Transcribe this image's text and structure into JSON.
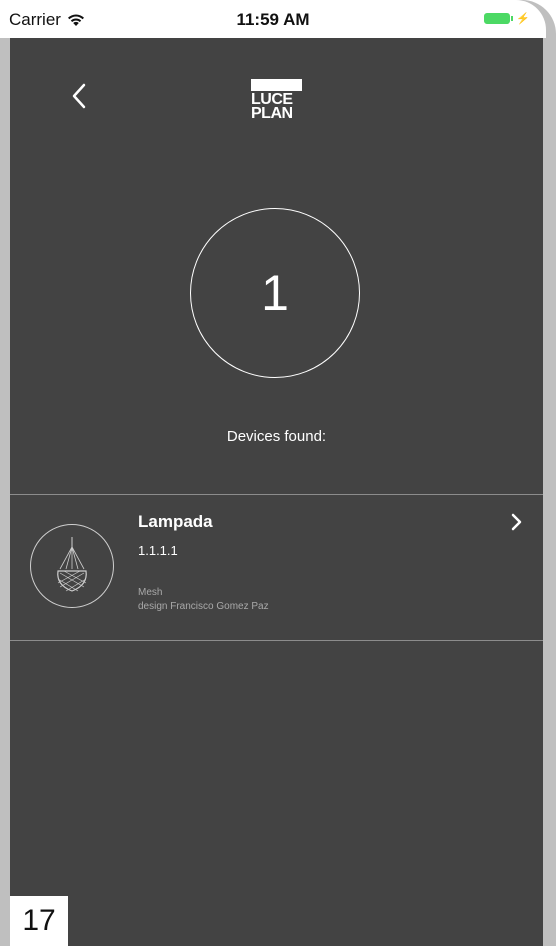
{
  "status_bar": {
    "carrier": "Carrier",
    "time": "11:59 AM",
    "battery_color": "#4cd964"
  },
  "header": {
    "back_icon": "chevron-left-icon",
    "logo_line1": "LUCE",
    "logo_line2": "PLAN"
  },
  "scan": {
    "count": "1",
    "label": "Devices found:"
  },
  "devices": [
    {
      "name": "Lampada",
      "version": "1.1.1.1",
      "model": "Mesh",
      "designer": "design Francisco Gomez Paz",
      "icon": "pendant-lamp-icon",
      "action_icon": "chevron-right-icon"
    }
  ],
  "page_number": "17",
  "colors": {
    "background": "#434343",
    "text": "#ffffff",
    "divider": "#8c8c8c",
    "secondary_text": "#a9a9a9"
  }
}
